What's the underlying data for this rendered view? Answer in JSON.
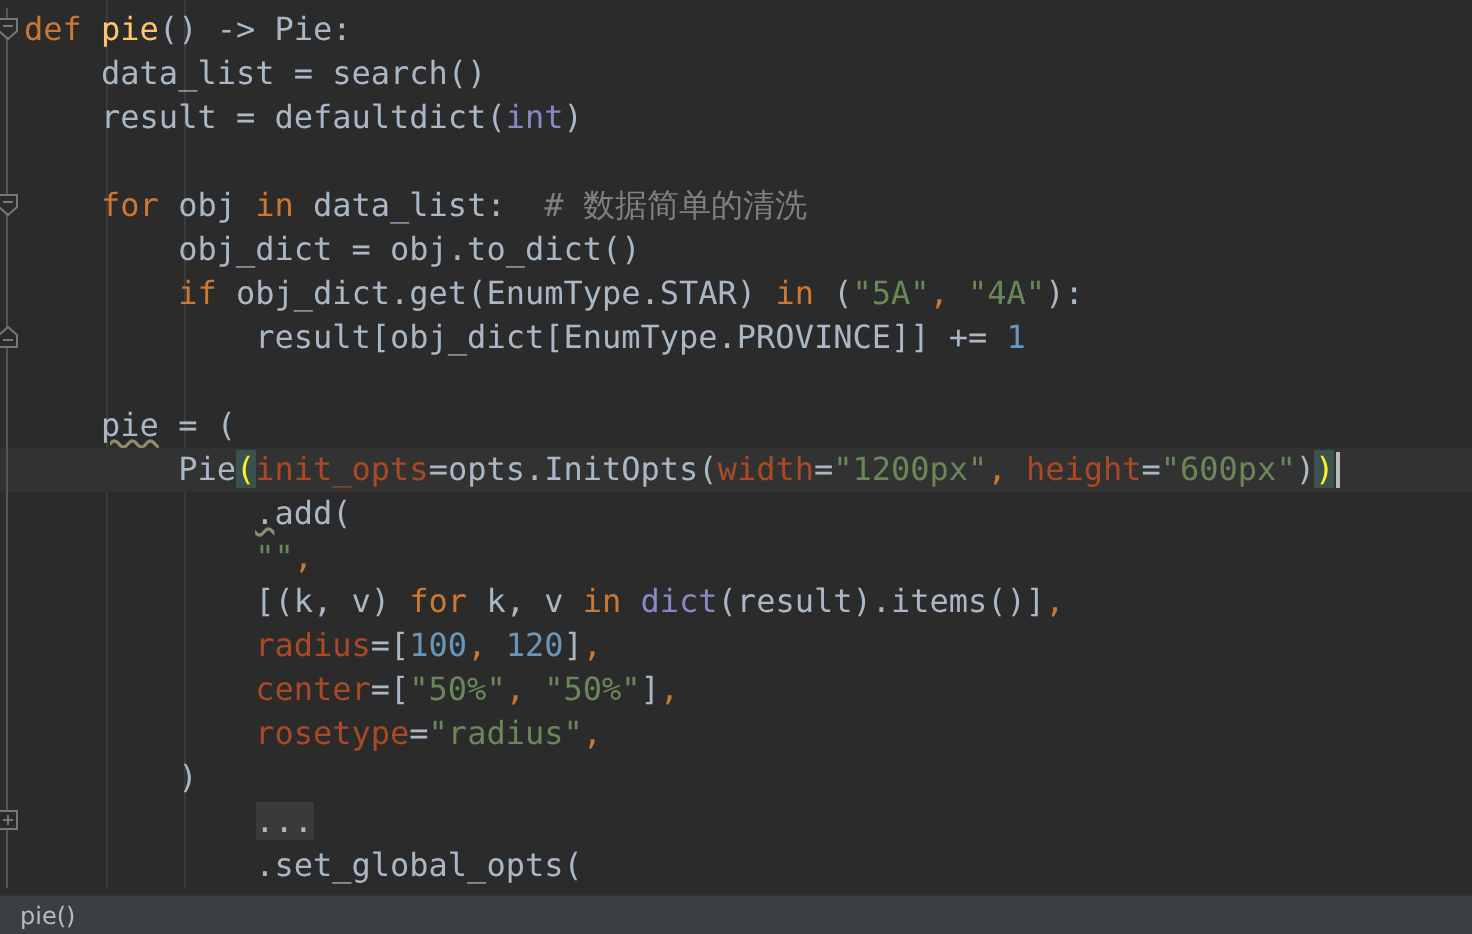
{
  "editor": {
    "lines": [
      {
        "kind": "fold",
        "current": false,
        "tokens": [
          {
            "kind": "keyword",
            "text": "def "
          },
          {
            "kind": "function",
            "text": "pie"
          },
          {
            "kind": "plain",
            "text": "() -> Pie:"
          }
        ]
      },
      {
        "kind": "code",
        "current": false,
        "tokens": [
          {
            "kind": "plain",
            "text": "    data_list = search()"
          }
        ]
      },
      {
        "kind": "code",
        "current": false,
        "tokens": [
          {
            "kind": "plain",
            "text": "    result = defaultdict("
          },
          {
            "kind": "builtin",
            "text": "int"
          },
          {
            "kind": "plain",
            "text": ")"
          }
        ]
      },
      {
        "kind": "code"
      },
      {
        "kind": "fold",
        "current": false,
        "tokens": [
          {
            "kind": "keyword",
            "text": "    for "
          },
          {
            "kind": "plain",
            "text": "obj "
          },
          {
            "kind": "keyword",
            "text": "in "
          },
          {
            "kind": "plain",
            "text": "data_list:  "
          },
          {
            "kind": "comment",
            "text": "# 数据简单的清洗"
          }
        ]
      },
      {
        "kind": "code",
        "current": false,
        "tokens": [
          {
            "kind": "plain",
            "text": "        obj_dict = obj.to_dict()"
          }
        ]
      },
      {
        "kind": "code",
        "current": false,
        "tokens": [
          {
            "kind": "keyword",
            "text": "        if "
          },
          {
            "kind": "plain",
            "text": "obj_dict.get(EnumType.STAR) "
          },
          {
            "kind": "keyword",
            "text": "in "
          },
          {
            "kind": "plain",
            "text": "("
          },
          {
            "kind": "string",
            "text": "\"5A\""
          },
          {
            "kind": "keyword",
            "text": ", "
          },
          {
            "kind": "string",
            "text": "\"4A\""
          },
          {
            "kind": "plain",
            "text": "):"
          }
        ]
      },
      {
        "kind": "foldend",
        "current": false,
        "tokens": [
          {
            "kind": "plain",
            "text": "            result[obj_dict[EnumType.PROVINCE]] += "
          },
          {
            "kind": "number",
            "text": "1"
          }
        ]
      },
      {
        "kind": "code"
      },
      {
        "kind": "code",
        "current": false,
        "tokens": [
          {
            "kind": "warning",
            "text": "    pie"
          },
          {
            "kind": "plain",
            "text": " = ("
          }
        ]
      },
      {
        "kind": "code",
        "current": true,
        "tokens": [
          {
            "kind": "plain",
            "text": "        Pie"
          },
          {
            "kind": "match",
            "text": "("
          },
          {
            "kind": "param",
            "text": "init_opts"
          },
          {
            "kind": "plain",
            "text": "=opts.InitOpts("
          },
          {
            "kind": "param",
            "text": "width"
          },
          {
            "kind": "plain",
            "text": "="
          },
          {
            "kind": "string",
            "text": "\"1200px\""
          },
          {
            "kind": "keyword",
            "text": ", "
          },
          {
            "kind": "param",
            "text": "height"
          },
          {
            "kind": "plain",
            "text": "="
          },
          {
            "kind": "string",
            "text": "\"600px\""
          },
          {
            "kind": "plain",
            "text": ")"
          },
          {
            "kind": "match",
            "text": ")"
          }
        ]
      },
      {
        "kind": "code",
        "current": false,
        "tokens": [
          {
            "kind": "warning",
            "text": "            ."
          },
          {
            "kind": "plain",
            "text": "add("
          }
        ]
      },
      {
        "kind": "code",
        "current": false,
        "tokens": [
          {
            "kind": "string",
            "text": "            \"\""
          },
          {
            "kind": "keyword",
            "text": ","
          }
        ]
      },
      {
        "kind": "code",
        "current": false,
        "tokens": [
          {
            "kind": "plain",
            "text": "            [(k, v) "
          },
          {
            "kind": "keyword",
            "text": "for "
          },
          {
            "kind": "plain",
            "text": "k, v "
          },
          {
            "kind": "keyword",
            "text": "in "
          },
          {
            "kind": "builtin",
            "text": "dict"
          },
          {
            "kind": "plain",
            "text": "(result).items()]"
          },
          {
            "kind": "keyword",
            "text": ","
          }
        ]
      },
      {
        "kind": "code",
        "current": false,
        "tokens": [
          {
            "kind": "param",
            "text": "            radius"
          },
          {
            "kind": "plain",
            "text": "=["
          },
          {
            "kind": "number",
            "text": "100"
          },
          {
            "kind": "keyword",
            "text": ", "
          },
          {
            "kind": "number",
            "text": "120"
          },
          {
            "kind": "plain",
            "text": "]"
          },
          {
            "kind": "keyword",
            "text": ","
          }
        ]
      },
      {
        "kind": "code",
        "current": false,
        "tokens": [
          {
            "kind": "param",
            "text": "            center"
          },
          {
            "kind": "plain",
            "text": "=["
          },
          {
            "kind": "string",
            "text": "\"50%\""
          },
          {
            "kind": "keyword",
            "text": ", "
          },
          {
            "kind": "string",
            "text": "\"50%\""
          },
          {
            "kind": "plain",
            "text": "]"
          },
          {
            "kind": "keyword",
            "text": ","
          }
        ]
      },
      {
        "kind": "code",
        "current": false,
        "tokens": [
          {
            "kind": "param",
            "text": "            rosetype"
          },
          {
            "kind": "plain",
            "text": "="
          },
          {
            "kind": "string",
            "text": "\"radius\""
          },
          {
            "kind": "keyword",
            "text": ","
          }
        ]
      },
      {
        "kind": "code",
        "current": false,
        "tokens": [
          {
            "kind": "plain",
            "text": "        )"
          }
        ]
      },
      {
        "kind": "collapsed",
        "current": false,
        "tokens": [
          {
            "kind": "folded",
            "text": "            ..."
          }
        ]
      },
      {
        "kind": "code",
        "current": false,
        "tokens": [
          {
            "kind": "plain",
            "text": "            .set_global_opts("
          }
        ]
      }
    ]
  },
  "status_bar": {
    "breadcrumb": "pie()"
  }
}
